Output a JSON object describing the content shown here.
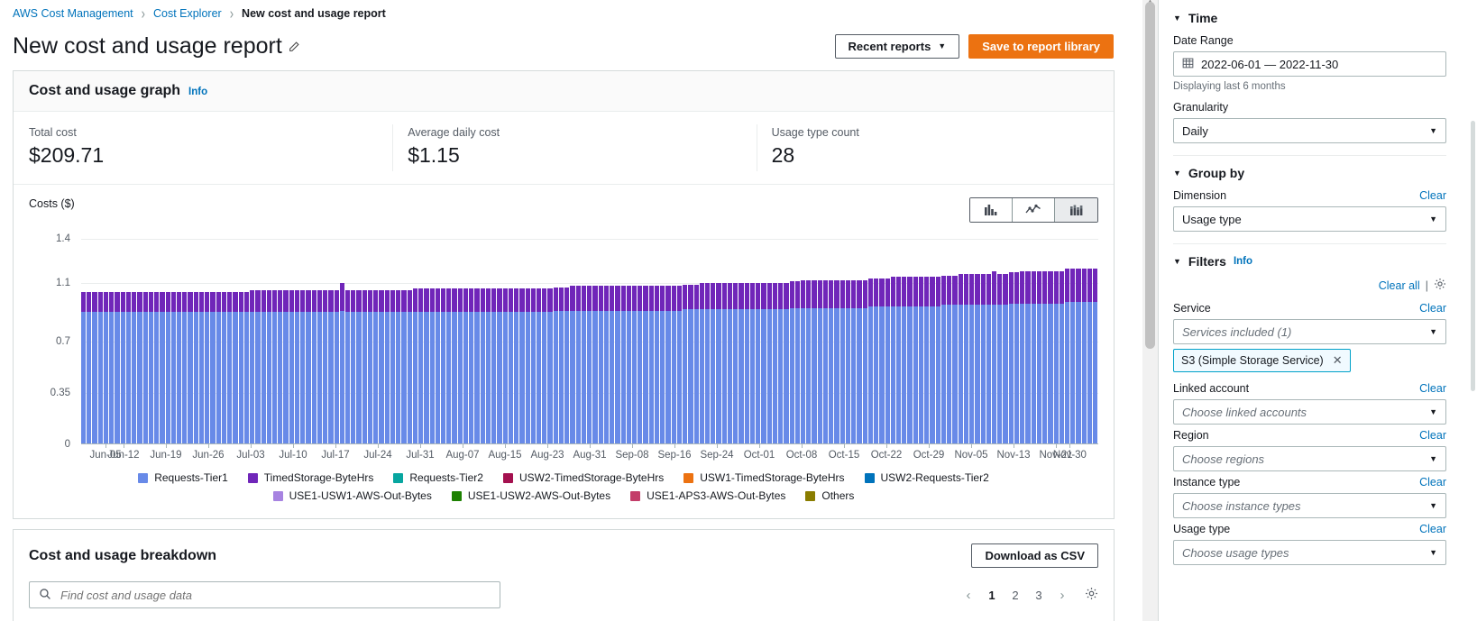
{
  "breadcrumb": {
    "items": [
      {
        "label": "AWS Cost Management",
        "current": false
      },
      {
        "label": "Cost Explorer",
        "current": false
      },
      {
        "label": "New cost and usage report",
        "current": true
      }
    ],
    "separator": "›"
  },
  "header": {
    "title": "New cost and usage report",
    "edit_icon": "edit-icon",
    "recent_reports_label": "Recent reports",
    "recent_reports_caret": "▼",
    "save_label": "Save to report library"
  },
  "graph_panel": {
    "title": "Cost and usage graph",
    "info_label": "Info",
    "metrics": [
      {
        "label": "Total cost",
        "value": "$209.71"
      },
      {
        "label": "Average daily cost",
        "value": "$1.15"
      },
      {
        "label": "Usage type count",
        "value": "28"
      }
    ],
    "chart_toggle": [
      {
        "name": "bar-chart-icon",
        "active": false
      },
      {
        "name": "line-chart-icon",
        "active": false
      },
      {
        "name": "stacked-bar-chart-icon",
        "active": true
      }
    ]
  },
  "chart_data": {
    "type": "bar",
    "stacked": true,
    "title": "",
    "ylabel": "Costs ($)",
    "xlabel": "",
    "ylim": [
      0,
      1.4
    ],
    "ytick_labels": [
      "1.4",
      "1.1",
      "0.7",
      "0.35",
      "0"
    ],
    "ytick_values": [
      1.4,
      1.1,
      0.7,
      0.35,
      0
    ],
    "grid": true,
    "legend_position": "bottom",
    "x_tick_labels": [
      "Jun-05",
      "Jun-12",
      "Jun-19",
      "Jun-26",
      "Jul-03",
      "Jul-10",
      "Jul-17",
      "Jul-24",
      "Jul-31",
      "Aug-07",
      "Aug-15",
      "Aug-23",
      "Aug-31",
      "Sep-08",
      "Sep-16",
      "Sep-24",
      "Oct-01",
      "Oct-08",
      "Oct-15",
      "Oct-22",
      "Oct-29",
      "Nov-05",
      "Nov-13",
      "Nov-21",
      "Nov-30"
    ],
    "series": [
      {
        "name": "Requests-Tier1",
        "color": "#688ae8",
        "values": [
          0.9,
          0.9,
          0.9,
          0.9,
          0.9,
          0.9,
          0.9,
          0.9,
          0.9,
          0.9,
          0.9,
          0.9,
          0.9,
          0.9,
          0.9,
          0.9,
          0.9,
          0.9,
          0.9,
          0.9,
          0.9,
          0.9,
          0.9,
          0.9,
          0.9,
          0.9,
          0.9,
          0.9,
          0.9,
          0.9,
          0.9,
          0.9,
          0.9,
          0.9,
          0.9,
          0.9,
          0.9,
          0.9,
          0.9,
          0.9,
          0.9,
          0.9,
          0.9,
          0.9,
          0.9,
          0.9,
          0.91,
          0.9,
          0.9,
          0.9,
          0.9,
          0.9,
          0.9,
          0.9,
          0.9,
          0.9,
          0.9,
          0.9,
          0.9,
          0.9,
          0.9,
          0.9,
          0.9,
          0.9,
          0.9,
          0.9,
          0.9,
          0.9,
          0.9,
          0.9,
          0.9,
          0.9,
          0.9,
          0.9,
          0.9,
          0.9,
          0.9,
          0.9,
          0.9,
          0.9,
          0.9,
          0.9,
          0.9,
          0.9,
          0.91,
          0.91,
          0.91,
          0.91,
          0.91,
          0.91,
          0.91,
          0.91,
          0.91,
          0.91,
          0.91,
          0.91,
          0.91,
          0.91,
          0.91,
          0.91,
          0.91,
          0.91,
          0.91,
          0.91,
          0.91,
          0.91,
          0.91,
          0.92,
          0.92,
          0.92,
          0.92,
          0.92,
          0.92,
          0.92,
          0.92,
          0.92,
          0.92,
          0.92,
          0.92,
          0.92,
          0.92,
          0.92,
          0.92,
          0.92,
          0.92,
          0.92,
          0.93,
          0.93,
          0.93,
          0.93,
          0.93,
          0.93,
          0.93,
          0.93,
          0.93,
          0.93,
          0.93,
          0.93,
          0.93,
          0.93,
          0.94,
          0.94,
          0.94,
          0.94,
          0.94,
          0.94,
          0.94,
          0.94,
          0.94,
          0.94,
          0.94,
          0.94,
          0.94,
          0.95,
          0.95,
          0.95,
          0.95,
          0.95,
          0.95,
          0.95,
          0.95,
          0.95,
          0.95,
          0.95,
          0.95,
          0.96,
          0.96,
          0.96,
          0.96,
          0.96,
          0.96,
          0.96,
          0.96,
          0.96,
          0.96,
          0.97,
          0.97,
          0.97,
          0.97,
          0.97,
          0.97
        ]
      },
      {
        "name": "TimedStorage-ByteHrs",
        "color": "#7026b9",
        "values": [
          0.14,
          0.14,
          0.14,
          0.14,
          0.14,
          0.14,
          0.14,
          0.14,
          0.14,
          0.14,
          0.14,
          0.14,
          0.14,
          0.14,
          0.14,
          0.14,
          0.14,
          0.14,
          0.14,
          0.14,
          0.14,
          0.14,
          0.14,
          0.14,
          0.14,
          0.14,
          0.14,
          0.14,
          0.14,
          0.14,
          0.15,
          0.15,
          0.15,
          0.15,
          0.15,
          0.15,
          0.15,
          0.15,
          0.15,
          0.15,
          0.15,
          0.15,
          0.15,
          0.15,
          0.15,
          0.15,
          0.19,
          0.15,
          0.15,
          0.15,
          0.15,
          0.15,
          0.15,
          0.15,
          0.15,
          0.15,
          0.15,
          0.15,
          0.15,
          0.16,
          0.16,
          0.16,
          0.16,
          0.16,
          0.16,
          0.16,
          0.16,
          0.16,
          0.16,
          0.16,
          0.16,
          0.16,
          0.16,
          0.16,
          0.16,
          0.16,
          0.16,
          0.16,
          0.16,
          0.16,
          0.16,
          0.16,
          0.16,
          0.16,
          0.16,
          0.16,
          0.16,
          0.17,
          0.17,
          0.17,
          0.17,
          0.17,
          0.17,
          0.17,
          0.17,
          0.17,
          0.17,
          0.17,
          0.17,
          0.17,
          0.17,
          0.17,
          0.17,
          0.17,
          0.17,
          0.17,
          0.17,
          0.17,
          0.17,
          0.17,
          0.18,
          0.18,
          0.18,
          0.18,
          0.18,
          0.18,
          0.18,
          0.18,
          0.18,
          0.18,
          0.18,
          0.18,
          0.18,
          0.18,
          0.18,
          0.18,
          0.18,
          0.18,
          0.19,
          0.19,
          0.19,
          0.19,
          0.19,
          0.19,
          0.19,
          0.19,
          0.19,
          0.19,
          0.19,
          0.19,
          0.19,
          0.19,
          0.19,
          0.19,
          0.2,
          0.2,
          0.2,
          0.2,
          0.2,
          0.2,
          0.2,
          0.2,
          0.2,
          0.2,
          0.2,
          0.2,
          0.21,
          0.21,
          0.21,
          0.21,
          0.21,
          0.21,
          0.23,
          0.21,
          0.21,
          0.21,
          0.21,
          0.22,
          0.22,
          0.22,
          0.22,
          0.22,
          0.22,
          0.22,
          0.22,
          0.23,
          0.23,
          0.23,
          0.23,
          0.23,
          0.23
        ]
      }
    ],
    "legend": [
      {
        "label": "Requests-Tier1",
        "color": "#688ae8"
      },
      {
        "label": "TimedStorage-ByteHrs",
        "color": "#7026b9"
      },
      {
        "label": "Requests-Tier2",
        "color": "#08a6a0"
      },
      {
        "label": "USW2-TimedStorage-ByteHrs",
        "color": "#a4114f"
      },
      {
        "label": "USW1-TimedStorage-ByteHrs",
        "color": "#ec7211"
      },
      {
        "label": "USW2-Requests-Tier2",
        "color": "#0073bb"
      },
      {
        "label": "USE1-USW1-AWS-Out-Bytes",
        "color": "#a783e1"
      },
      {
        "label": "USE1-USW2-AWS-Out-Bytes",
        "color": "#1d8102"
      },
      {
        "label": "USE1-APS3-AWS-Out-Bytes",
        "color": "#c33d69"
      },
      {
        "label": "Others",
        "color": "#8a7d00"
      }
    ]
  },
  "breakdown": {
    "title": "Cost and usage breakdown",
    "download_label": "Download as CSV",
    "search_icon": "search-icon",
    "search_placeholder": "Find cost and usage data",
    "search_value": "",
    "pager": {
      "prev_icon": "‹",
      "next_icon": "›",
      "pages": [
        "1",
        "2",
        "3"
      ],
      "current_page": "1",
      "settings_icon": "gear-icon"
    }
  },
  "right_panel": {
    "time": {
      "section_title": "Time",
      "caret": "▼",
      "date_range_label": "Date Range",
      "calendar_icon": "calendar-icon",
      "date_range_value": "2022-06-01 — 2022-11-30",
      "hint": "Displaying last 6 months",
      "granularity_label": "Granularity",
      "granularity_value": "Daily"
    },
    "group_by": {
      "section_title": "Group by",
      "caret": "▼",
      "dimension_label": "Dimension",
      "dimension_clear": "Clear",
      "dimension_value": "Usage type"
    },
    "filters": {
      "section_title": "Filters",
      "caret": "▼",
      "info_label": "Info",
      "clear_all_label": "Clear all",
      "separator": "|",
      "settings_icon": "gear-icon",
      "rows": [
        {
          "label": "Service",
          "clear": "Clear",
          "value": "Services included (1)",
          "is_placeholder": true,
          "token": "S3 (Simple Storage Service)",
          "token_close": "✕"
        },
        {
          "label": "Linked account",
          "clear": "Clear",
          "value": "Choose linked accounts",
          "is_placeholder": true,
          "token": null
        },
        {
          "label": "Region",
          "clear": "Clear",
          "value": "Choose regions",
          "is_placeholder": true,
          "token": null
        },
        {
          "label": "Instance type",
          "clear": "Clear",
          "value": "Choose instance types",
          "is_placeholder": true,
          "token": null
        },
        {
          "label": "Usage type",
          "clear": "Clear",
          "value": "Choose usage types",
          "is_placeholder": true,
          "token": null
        }
      ]
    },
    "drag_handle": "‖"
  }
}
